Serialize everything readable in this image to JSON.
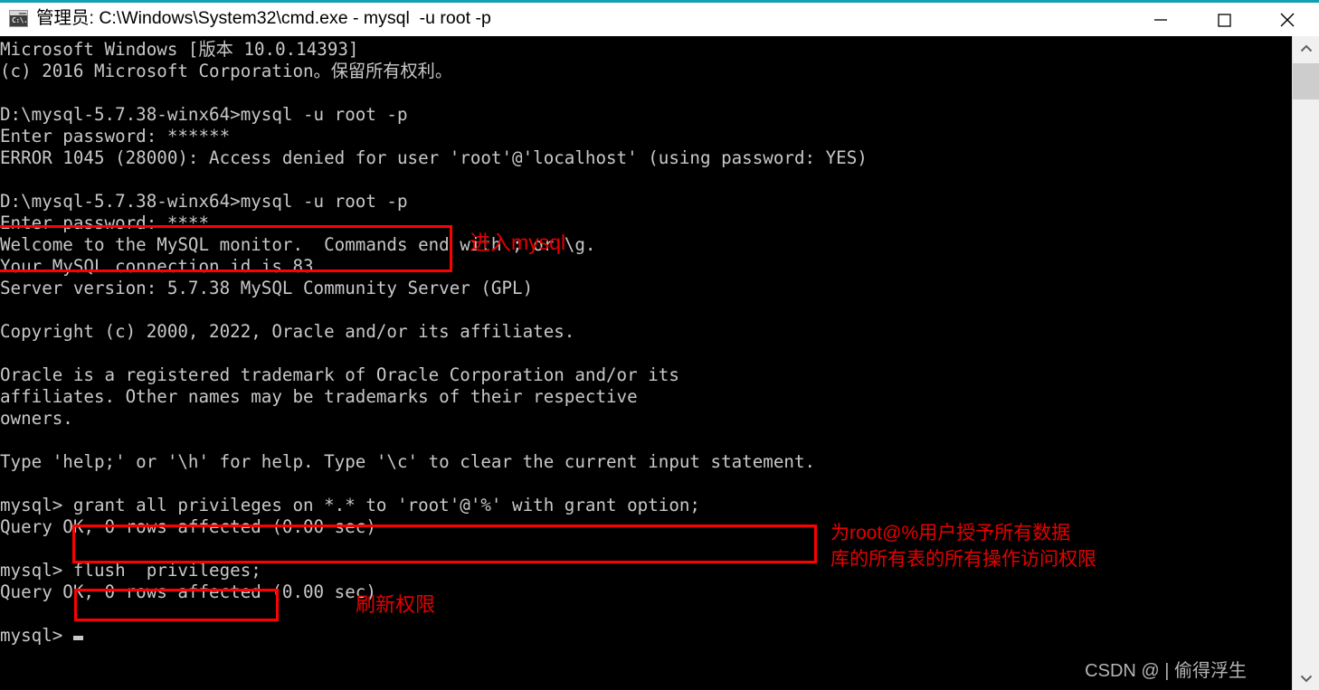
{
  "window": {
    "title": "管理员: C:\\Windows\\System32\\cmd.exe - mysql  -u root -p",
    "icon_name": "cmd-exe-icon",
    "icon_prompt_text": "C:\\.",
    "accent_color": "#12a0b1",
    "controls": {
      "minimize_label": "Minimize",
      "maximize_label": "Maximize",
      "close_label": "Close"
    }
  },
  "console": {
    "background_color": "#000000",
    "foreground_color": "#c8c8c8",
    "lines": [
      "Microsoft Windows [版本 10.0.14393]",
      "(c) 2016 Microsoft Corporation。保留所有权利。",
      "",
      "D:\\mysql-5.7.38-winx64>mysql -u root -p",
      "Enter password: ******",
      "ERROR 1045 (28000): Access denied for user 'root'@'localhost' (using password: YES)",
      "",
      "D:\\mysql-5.7.38-winx64>mysql -u root -p",
      "Enter password: ****",
      "Welcome to the MySQL monitor.  Commands end with ; or \\g.",
      "Your MySQL connection id is 83",
      "Server version: 5.7.38 MySQL Community Server (GPL)",
      "",
      "Copyright (c) 2000, 2022, Oracle and/or its affiliates.",
      "",
      "Oracle is a registered trademark of Oracle Corporation and/or its",
      "affiliates. Other names may be trademarks of their respective",
      "owners.",
      "",
      "Type 'help;' or '\\h' for help. Type '\\c' to clear the current input statement.",
      "",
      "mysql> grant all privileges on *.* to 'root'@'%' with grant option;",
      "Query OK, 0 rows affected (0.00 sec)",
      "",
      "mysql> flush  privileges;",
      "Query OK, 0 rows affected (0.00 sec)",
      "",
      "mysql>"
    ]
  },
  "annotations": {
    "color": "#e60000",
    "boxes": [
      {
        "name": "login-command-highlight",
        "target": "D:\\mysql-5.7.38-winx64>mysql -u root -p / Enter password: ****"
      },
      {
        "name": "grant-command-highlight",
        "target": "grant all privileges on *.* to 'root'@'%' with grant option;"
      },
      {
        "name": "flush-command-highlight",
        "target": "flush  privileges;"
      }
    ],
    "notes": [
      {
        "name": "enter-mysql-note",
        "text": "进入mysql"
      },
      {
        "name": "grant-privileges-note",
        "line1": "为root@%用户授予所有数据",
        "line2": "库的所有表的所有操作访问权限"
      },
      {
        "name": "flush-privileges-note",
        "text": "刷新权限"
      }
    ]
  },
  "watermark": {
    "text": "CSDN @ | 偷得浮生"
  },
  "scrollbar": {
    "up_arrow": "chevron-up",
    "down_arrow": "chevron-down",
    "thumb_label": "scroll-thumb"
  }
}
